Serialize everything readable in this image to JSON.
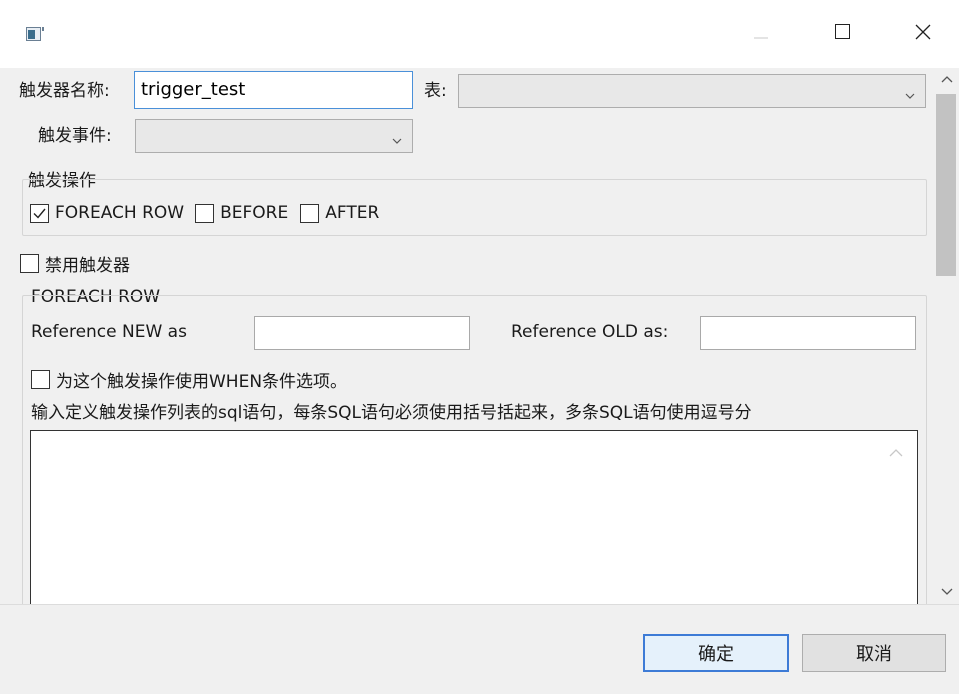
{
  "window": {
    "title": "",
    "icon": "app-window-icon",
    "controls": [
      "minimize-icon",
      "maximize-icon",
      "close-icon"
    ]
  },
  "form": {
    "trigger_name_label": "触发器名称:",
    "trigger_name_value": "trigger_test",
    "table_label": "表:",
    "table_value": "",
    "event_label": "触发事件:",
    "event_value": ""
  },
  "trigger_action": {
    "group_title": "触发操作",
    "options": [
      {
        "label": "FOREACH ROW",
        "checked": true
      },
      {
        "label": "BEFORE",
        "checked": false
      },
      {
        "label": "AFTER",
        "checked": false
      }
    ]
  },
  "disable_trigger": {
    "label": "禁用触发器",
    "checked": false
  },
  "foreach_row": {
    "group_title": "FOREACH ROW",
    "ref_new_label": "Reference NEW as",
    "ref_new_value": "",
    "ref_old_label": "Reference OLD as:",
    "ref_old_value": "",
    "when_option": {
      "label": "为这个触发操作使用WHEN条件选项。",
      "checked": false
    },
    "sql_hint": "输入定义触发操作列表的sql语句，每条SQL语句必须使用括号括起来，多条SQL语句使用逗号分",
    "sql_text": ""
  },
  "footer": {
    "ok_label": "确定",
    "cancel_label": "取消"
  },
  "colors": {
    "focus_border": "#4a90d9",
    "primary_button_border": "#3d7bd6",
    "background": "#f0f0f0"
  }
}
